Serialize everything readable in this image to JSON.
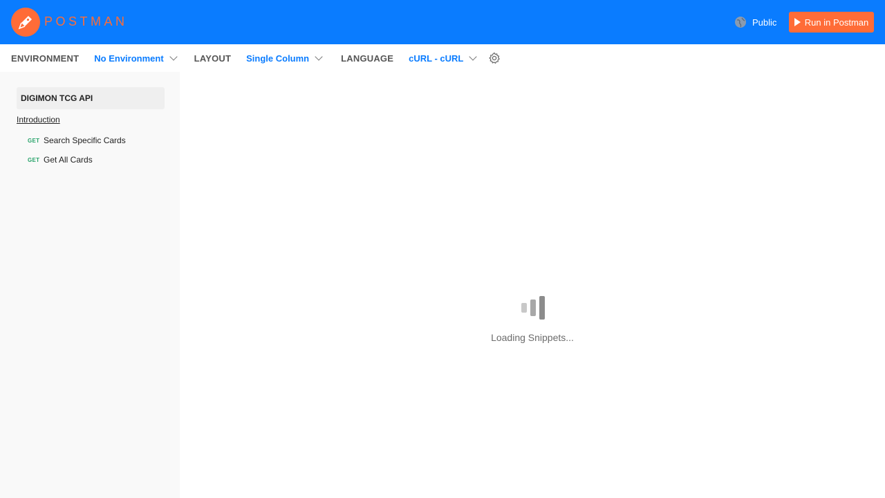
{
  "header": {
    "brand": "POSTMAN",
    "visibility_label": "Public",
    "run_button_label": "Run in Postman"
  },
  "toolbar": {
    "environment_label": "ENVIRONMENT",
    "environment_value": "No Environment",
    "layout_label": "LAYOUT",
    "layout_value": "Single Column",
    "language_label": "LANGUAGE",
    "language_value": "cURL - cURL"
  },
  "sidebar": {
    "collection_title": "DIGIMON TCG API",
    "intro_link": "Introduction",
    "requests": [
      {
        "method": "GET",
        "name": "Search Specific Cards"
      },
      {
        "method": "GET",
        "name": "Get All Cards"
      }
    ]
  },
  "main": {
    "loading_text": "Loading Snippets..."
  },
  "colors": {
    "header_bg": "#0a7cff",
    "brand_orange": "#ff6c37",
    "link_blue": "#0a7cff",
    "get_green": "#26a269"
  },
  "icons": {
    "logo": "postman-logo-icon",
    "globe": "globe-icon",
    "play": "play-icon",
    "gear": "gear-icon",
    "chevron": "chevron-down-icon",
    "loader": "loading-bars-icon"
  }
}
